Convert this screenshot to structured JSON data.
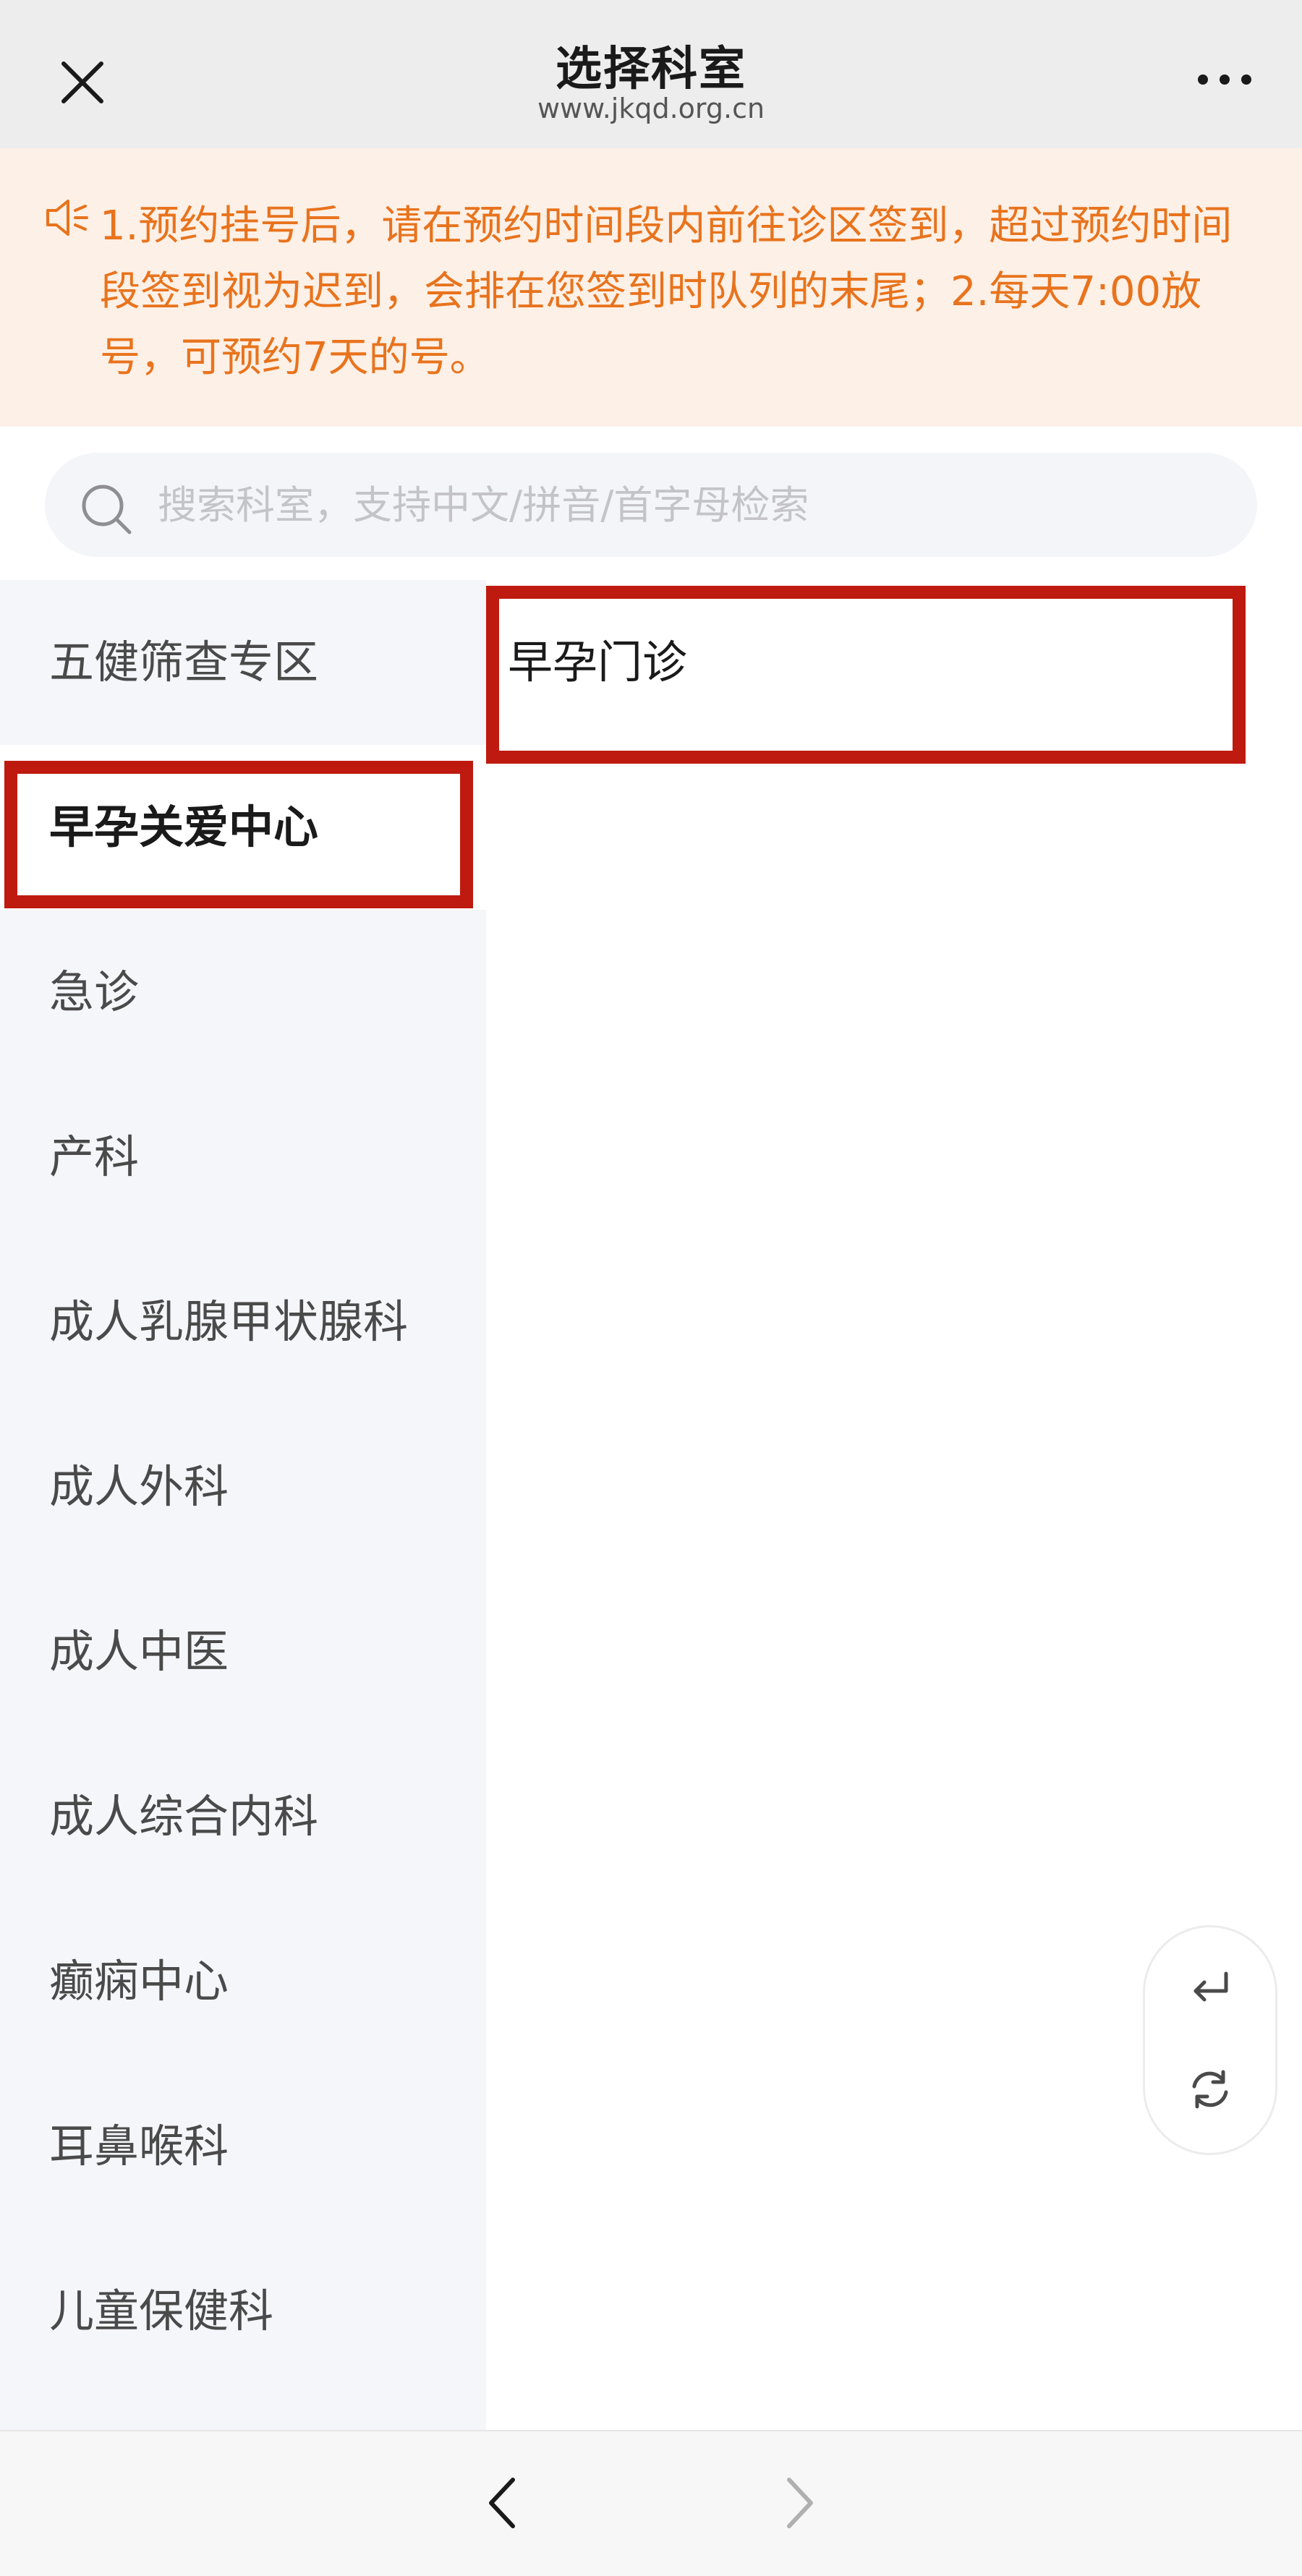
{
  "header": {
    "title": "选择科室",
    "url": "www.jkqd.org.cn",
    "close_icon": "close-icon",
    "more_icon": "more-icon"
  },
  "notice": {
    "icon": "speaker-icon",
    "text": "1.预约挂号后，请在预约时间段内前往诊区签到，超过预约时间段签到视为迟到，会排在您签到时队列的末尾；2.每天7:00放号，可预约7天的号。"
  },
  "search": {
    "placeholder": "搜索科室，支持中文/拼音/首字母检索",
    "value": ""
  },
  "sidebar": {
    "items": [
      {
        "label": "五健筛查专区",
        "active": false
      },
      {
        "label": "早孕关爱中心",
        "active": true
      },
      {
        "label": "急诊",
        "active": false
      },
      {
        "label": "产科",
        "active": false
      },
      {
        "label": "成人乳腺甲状腺科",
        "active": false
      },
      {
        "label": "成人外科",
        "active": false
      },
      {
        "label": "成人中医",
        "active": false
      },
      {
        "label": "成人综合内科",
        "active": false
      },
      {
        "label": "癫痫中心",
        "active": false
      },
      {
        "label": "耳鼻喉科",
        "active": false
      },
      {
        "label": "儿童保健科",
        "active": false
      }
    ]
  },
  "departments": {
    "items": [
      {
        "label": "早孕门诊"
      }
    ]
  },
  "floating_tools": {
    "return_icon": "return-icon",
    "refresh_icon": "refresh-icon"
  },
  "bottom_nav": {
    "back_icon": "chevron-left-icon",
    "forward_icon": "chevron-right-icon"
  },
  "colors": {
    "notice_text": "#e8731d",
    "notice_bg": "#fdf0e6",
    "highlight": "#bf1a0f",
    "sidebar_bg": "#f5f6fa"
  }
}
